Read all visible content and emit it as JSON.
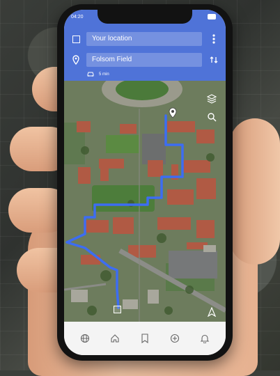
{
  "status": {
    "time": "04:20"
  },
  "search": {
    "origin": "Your location",
    "destination": "Folsom Field",
    "eta": "5 min"
  },
  "icons": {
    "origin": "square-icon",
    "destination": "map-pin-icon",
    "menu": "more-vert-icon",
    "swap": "swap-vertical-icon",
    "car": "car-icon",
    "layers": "layers-icon",
    "search": "search-icon",
    "destination_marker": "pin-icon",
    "start_marker": "start-square-icon",
    "compass": "compass-icon"
  },
  "bottom_nav": [
    {
      "name": "globe",
      "icon": "globe-icon"
    },
    {
      "name": "home",
      "icon": "home-icon"
    },
    {
      "name": "bookmark",
      "icon": "bookmark-icon"
    },
    {
      "name": "add",
      "icon": "add-circle-icon"
    },
    {
      "name": "notifications",
      "icon": "bell-icon"
    }
  ],
  "colors": {
    "accent": "#4f73d8",
    "route": "#3d6df2"
  }
}
